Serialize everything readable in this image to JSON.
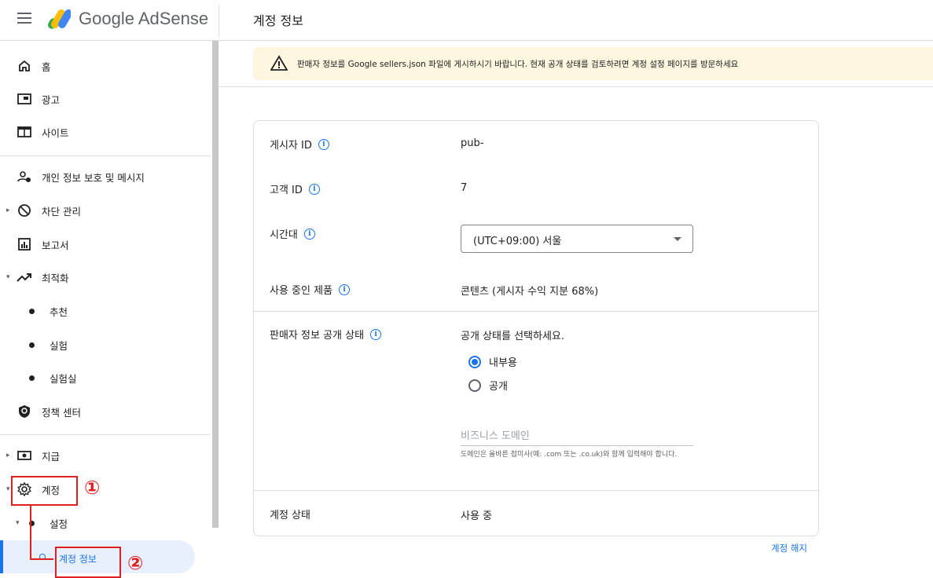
{
  "header": {
    "logo_text": "Google AdSense",
    "page_title": "계정 정보"
  },
  "sidebar": {
    "items": [
      {
        "label": "홈",
        "icon": "home-icon"
      },
      {
        "label": "광고",
        "icon": "ads-icon"
      },
      {
        "label": "사이트",
        "icon": "sites-icon"
      },
      {
        "label": "개인 정보 보호 및 메시지",
        "icon": "privacy-icon"
      },
      {
        "label": "차단 관리",
        "icon": "block-icon"
      },
      {
        "label": "보고서",
        "icon": "report-icon"
      },
      {
        "label": "최적화",
        "icon": "optimize-icon"
      },
      {
        "label": "추천"
      },
      {
        "label": "실험"
      },
      {
        "label": "실험실"
      },
      {
        "label": "정책 센터",
        "icon": "policy-icon"
      },
      {
        "label": "지급",
        "icon": "payment-icon"
      },
      {
        "label": "계정",
        "icon": "gear-icon"
      },
      {
        "label": "설정"
      },
      {
        "label": "계정 정보"
      }
    ]
  },
  "banner": {
    "text": "판매자 정보를 Google sellers.json 파일에 게시하시기 바랍니다. 현재 공개 상태를 검토하려면 계정 설정 페이지를 방문하세요"
  },
  "account": {
    "publisher_id_label": "게시자 ID",
    "publisher_id_value": "pub-",
    "customer_id_label": "고객 ID",
    "customer_id_value": "7",
    "timezone_label": "시간대",
    "timezone_value": "(UTC+09:00) 서울",
    "product_label": "사용 중인 제품",
    "product_value": "콘텐츠 (게시자 수익 지분 68%)",
    "seller_visibility_label": "판매자 정보 공개 상태",
    "seller_visibility_prompt": "공개 상태를 선택하세요.",
    "radio_internal": "내부용",
    "radio_public": "공개",
    "business_domain_placeholder": "비즈니스 도메인",
    "business_domain_hint": "도메인은 올바른 접미사(예: .com 또는 .co.uk)와 함께 입력해야 합니다.",
    "status_label": "계정 상태",
    "status_value": "사용 중",
    "cancel_link": "계정 해지"
  },
  "annotations": {
    "step1": "①",
    "step2": "②"
  },
  "colors": {
    "accent": "#1a73e8",
    "banner_bg": "#fef7e0",
    "annotation": "#e02020"
  }
}
